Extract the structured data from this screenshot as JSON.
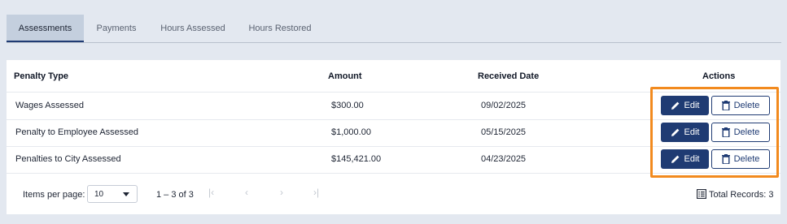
{
  "tabs": [
    {
      "label": "Assessments",
      "active": true
    },
    {
      "label": "Payments",
      "active": false
    },
    {
      "label": "Hours Assessed",
      "active": false
    },
    {
      "label": "Hours Restored",
      "active": false
    }
  ],
  "table": {
    "headers": {
      "penalty_type": "Penalty Type",
      "amount": "Amount",
      "received_date": "Received Date",
      "actions": "Actions"
    },
    "rows": [
      {
        "penalty_type": "Wages Assessed",
        "amount": "$300.00",
        "received_date": "09/02/2025"
      },
      {
        "penalty_type": "Penalty to Employee Assessed",
        "amount": "$1,000.00",
        "received_date": "05/15/2025"
      },
      {
        "penalty_type": "Penalties to City Assessed",
        "amount": "$145,421.00",
        "received_date": "04/23/2025"
      }
    ],
    "edit_label": "Edit",
    "delete_label": "Delete"
  },
  "footer": {
    "items_per_page_label": "Items per page:",
    "items_per_page_value": "10",
    "range": "1 – 3 of 3",
    "total_records": "Total Records: 3"
  },
  "icons": {
    "edit": "pencil-icon",
    "delete": "trash-icon",
    "first_page": "first-page-icon",
    "prev_page": "chevron-left-icon",
    "next_page": "chevron-right-icon",
    "last_page": "last-page-icon",
    "total": "list-icon"
  },
  "colors": {
    "primary": "#1f3b73",
    "highlight": "#f28a1e",
    "background": "#e3e8f0",
    "active_tab": "#c4cfde"
  }
}
